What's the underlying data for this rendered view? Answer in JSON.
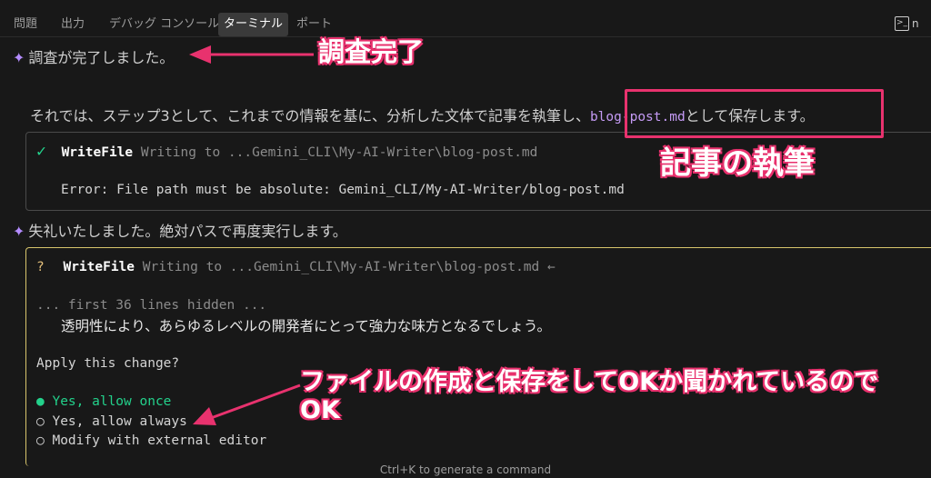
{
  "tabs": [
    {
      "label": "問題"
    },
    {
      "label": "出力"
    },
    {
      "label": "デバッグ コンソール"
    },
    {
      "label": "ターミナル",
      "active": true
    },
    {
      "label": "ポート"
    }
  ],
  "terminal_button": {
    "label": "n"
  },
  "messages": {
    "survey_done": "調査が完了しました。",
    "step3_prefix": "それでは、ステップ3として、これまでの情報を基に、分析した文体で記事を執筆し、",
    "step3_file": "blog-post.md",
    "step3_suffix": "として保存します。",
    "retry": "失礼いたしました。絶対パスで再度実行します。"
  },
  "tool_call_1": {
    "status_icon": "✓",
    "tool": "WriteFile",
    "desc": "Writing to ...Gemini_CLI\\My-AI-Writer\\blog-post.md",
    "error": "Error: File path must be absolute: Gemini_CLI/My-AI-Writer/blog-post.md"
  },
  "tool_call_2": {
    "status_icon": "?",
    "tool": "WriteFile",
    "desc": "Writing to ...Gemini_CLI\\My-AI-Writer\\blog-post.md ←",
    "hidden_note": "... first 36 lines hidden ...",
    "content_line": "透明性により、あらゆるレベルの開発者にとって強力な味方となるでしょう。",
    "prompt": "Apply this change?",
    "options": [
      {
        "marker": "●",
        "label": "Yes, allow once",
        "selected": true
      },
      {
        "marker": "○",
        "label": "Yes, allow always",
        "selected": false
      },
      {
        "marker": "○",
        "label": "Modify with external editor",
        "selected": false
      }
    ]
  },
  "annotations": {
    "survey_done": "調査完了",
    "writing": "記事の執筆",
    "confirm_line1": "ファイルの作成と保存をしてOKか聞かれているので",
    "confirm_line2": "OK"
  },
  "footer_hint": "Ctrl+K to generate a command",
  "colors": {
    "accent_pink": "#e8326e",
    "success_green": "#23d18b",
    "confirm_yellow": "#d8c56c",
    "sparkle_purple": "#b48cff"
  }
}
